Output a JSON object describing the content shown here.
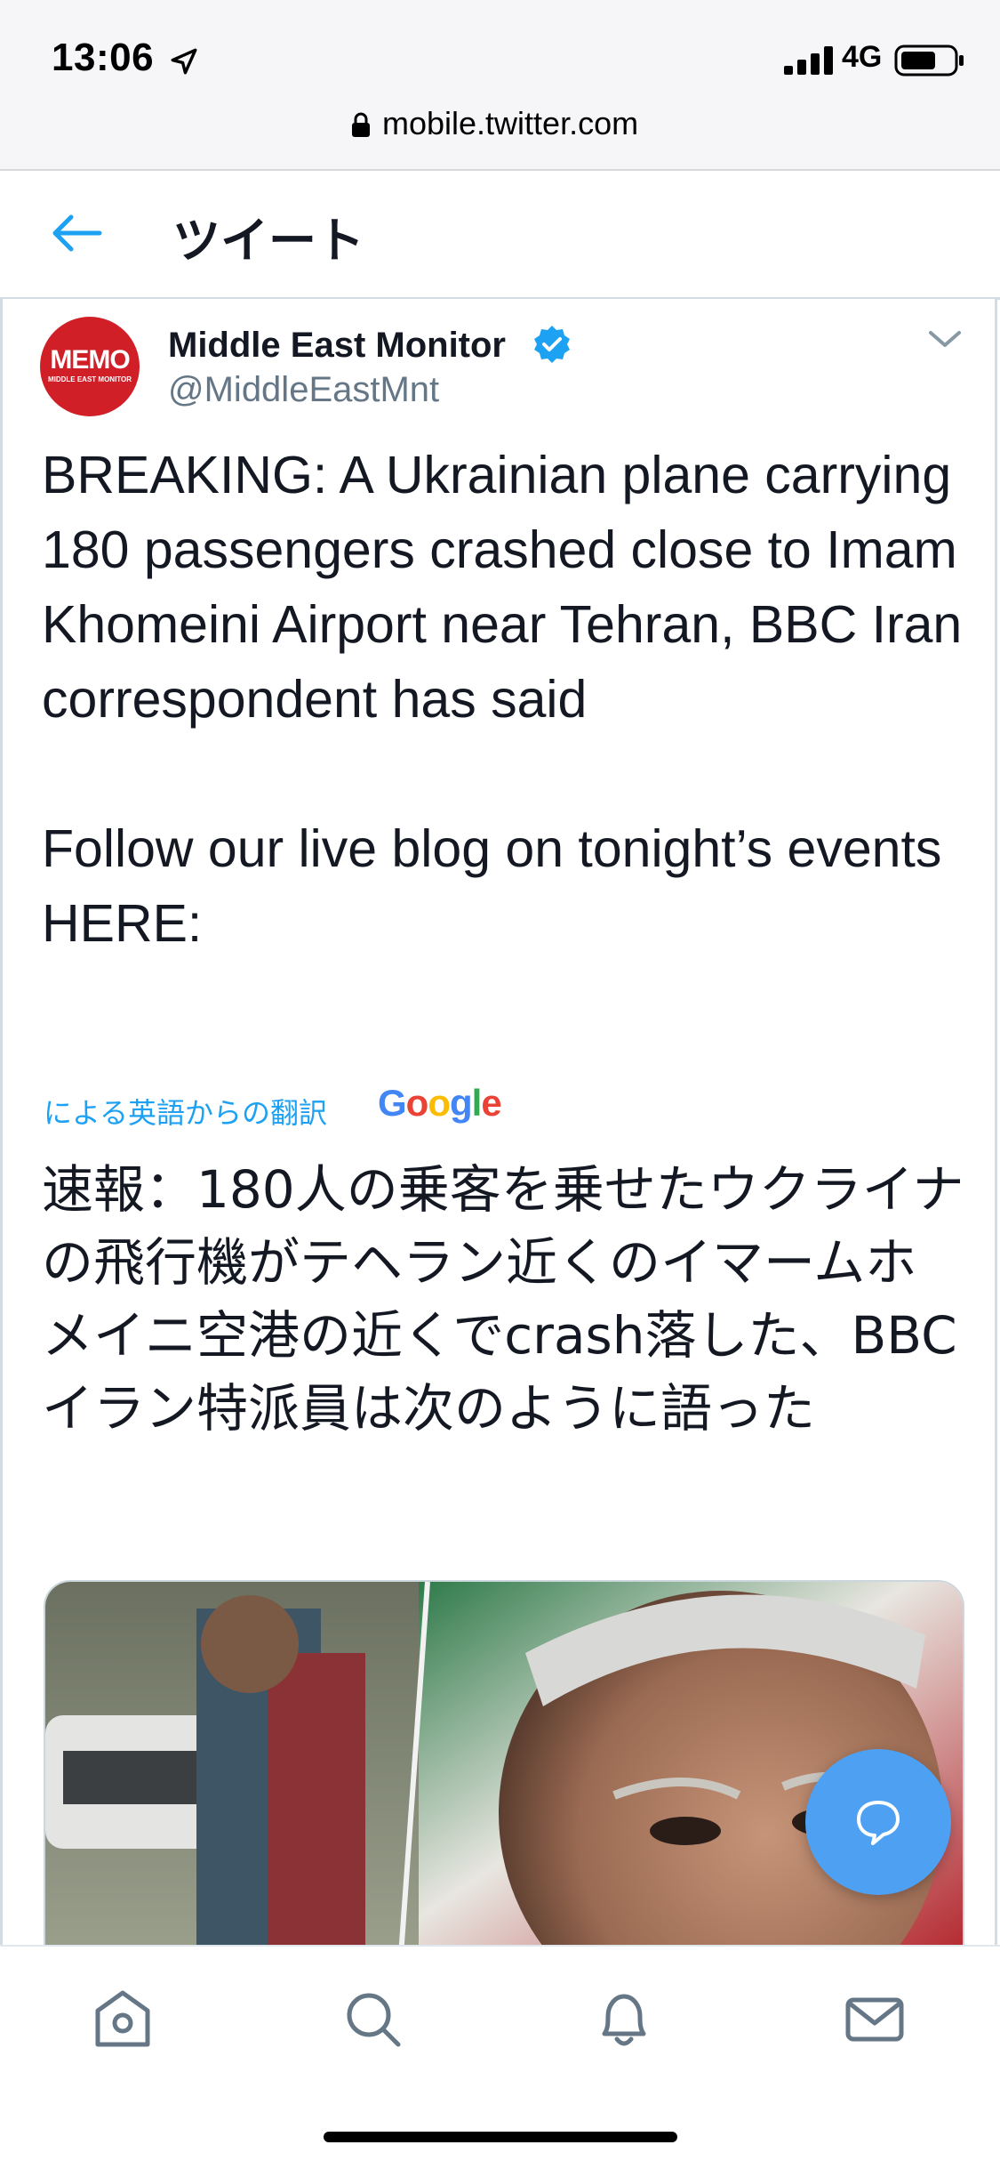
{
  "status_bar": {
    "time": "13:06",
    "network": "4G",
    "icons": [
      "location-arrow-icon",
      "signal-icon",
      "battery-icon"
    ]
  },
  "browser": {
    "url": "mobile.twitter.com",
    "icon": "lock-icon"
  },
  "header": {
    "title": "ツイート",
    "back_icon": "back-arrow-icon"
  },
  "tweet": {
    "avatar_text": "MEMO",
    "avatar_subtext": "MIDDLE EAST MONITOR",
    "display_name": "Middle East Monitor",
    "verified": true,
    "handle": "@MiddleEastMnt",
    "text": "BREAKING: A Ukrainian plane carrying 180 passengers crashed close to Imam Khomeini Airport near Tehran, BBC Iran correspondent has said\n\nFollow our live blog on tonight’s events HERE:",
    "translation_note": "による英語からの翻訳",
    "translation_provider": "Google",
    "translated_text": "速報：180人の乗客を乗せたウクライナの飛行機がテヘラン近くのイマームホメイニ空港の近くでcrash落した、BBCイラン特派員は次のように語った"
  },
  "bottom_nav": {
    "items": [
      "home-icon",
      "search-icon",
      "notifications-bell-icon",
      "messages-envelope-icon"
    ]
  },
  "colors": {
    "accent": "#1da1f2",
    "fab": "#4ea1f2",
    "avatar": "#d11f28",
    "text": "#141823",
    "secondary_text": "#657786"
  }
}
